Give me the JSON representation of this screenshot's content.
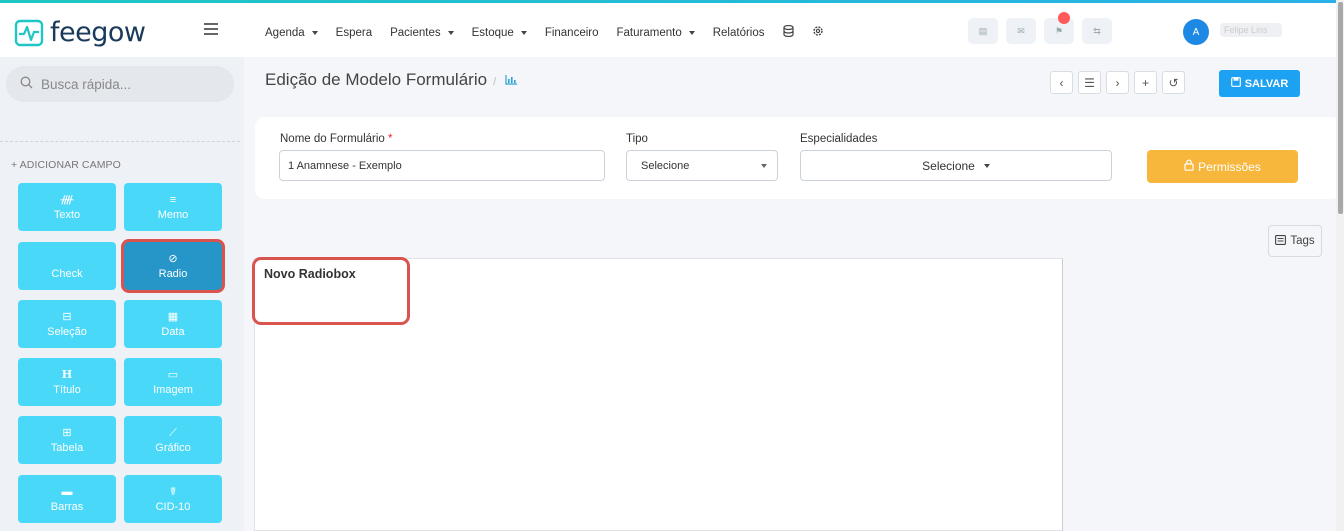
{
  "brand": {
    "name": "feegow",
    "color": "#1ec7c3"
  },
  "nav": {
    "items": [
      {
        "label": "Agenda",
        "dropdown": true
      },
      {
        "label": "Espera",
        "dropdown": false
      },
      {
        "label": "Pacientes",
        "dropdown": true
      },
      {
        "label": "Estoque",
        "dropdown": true
      },
      {
        "label": "Financeiro",
        "dropdown": false
      },
      {
        "label": "Faturamento",
        "dropdown": true
      },
      {
        "label": "Relatórios",
        "dropdown": false
      }
    ],
    "icons": [
      "database-icon",
      "gear-icon"
    ]
  },
  "user": {
    "initial": "A",
    "name": "Felipe Lins"
  },
  "search": {
    "placeholder": "Busca rápida..."
  },
  "sidebar": {
    "add_label": "+ ADICIONAR CAMPO",
    "fields": [
      {
        "label": "Texto",
        "icon": "𝅝",
        "name": "text"
      },
      {
        "label": "Memo",
        "icon": "≡",
        "name": "memo"
      },
      {
        "label": "Check",
        "icon": "",
        "name": "check"
      },
      {
        "label": "Radio",
        "icon": "⊘",
        "name": "radio"
      },
      {
        "label": "Seleção",
        "icon": "⊟",
        "name": "selection"
      },
      {
        "label": "Data",
        "icon": "▦",
        "name": "date"
      },
      {
        "label": "Título",
        "icon": "H",
        "name": "title"
      },
      {
        "label": "Imagem",
        "icon": "▭",
        "name": "image"
      },
      {
        "label": "Tabela",
        "icon": "⊞",
        "name": "table"
      },
      {
        "label": "Gráfico",
        "icon": "⟋",
        "name": "chart"
      },
      {
        "label": "Barras",
        "icon": "▬",
        "name": "bars"
      },
      {
        "label": "CID-10",
        "icon": "☤",
        "name": "cid10"
      }
    ]
  },
  "page": {
    "title": "Edição de Modelo Formulário",
    "save_label": "SALVAR"
  },
  "form": {
    "name_label": "Nome do Formulário",
    "name_required": "*",
    "name_value": "1 Anamnese - Exemplo",
    "type_label": "Tipo",
    "type_value": "Selecione",
    "specialties_label": "Especialidades",
    "specialties_value": "Selecione",
    "permissions_label": "Permissões"
  },
  "tags_label": "Tags",
  "canvas": {
    "radiobox_label": "Novo Radiobox"
  },
  "colors": {
    "field_button": "#4ad8f9",
    "field_button_active": "#2596c7",
    "save": "#1da1f2",
    "permissions": "#f6b73c",
    "highlight": "#d9534f"
  }
}
